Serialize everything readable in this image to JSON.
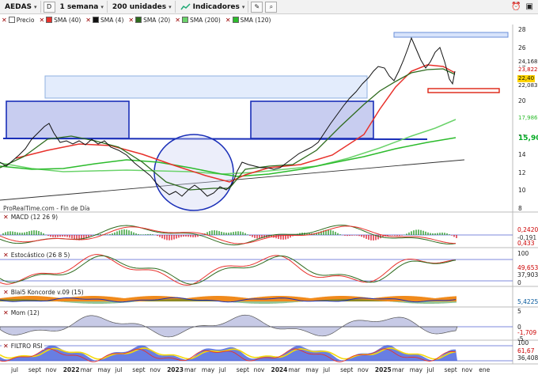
{
  "toolbar": {
    "symbol": "AEDAS",
    "period_letter": "D",
    "timeframe": "1 semana",
    "units": "200 unidades",
    "indicators": "Indicadores"
  },
  "legend": [
    {
      "label": "Precio",
      "color": "#ffffff"
    },
    {
      "label": "SMA (40)",
      "color": "#e8312b"
    },
    {
      "label": "SMA (4)",
      "color": "#111111"
    },
    {
      "label": "SMA (20)",
      "color": "#2e6b1e"
    },
    {
      "label": "SMA (200)",
      "color": "#6bd36b"
    },
    {
      "label": "SMA (120)",
      "color": "#2cbb2c"
    }
  ],
  "price_axis": [
    "28",
    "26",
    "24",
    "22",
    "20",
    "18",
    "16",
    "14",
    "12",
    "10",
    "8"
  ],
  "price_tags": [
    {
      "text": "24,168",
      "bg": "#ffffff",
      "color": "#222"
    },
    {
      "text": "23,822",
      "bg": "#ffffff",
      "color": "#c00"
    },
    {
      "text": "22,40",
      "bg": "#ffd400",
      "color": "#111"
    },
    {
      "text": "22,083",
      "bg": "#ffffff",
      "color": "#222"
    },
    {
      "text": "17,986",
      "bg": "#ffffff",
      "color": "#2cbb2c"
    },
    {
      "text": "15,90",
      "bg": "#ffffff",
      "color": "#0a2"
    }
  ],
  "footer": "ProRealTime.com - Fin de Día",
  "panels": {
    "macd": {
      "title": "MACD (12 26 9)",
      "values": [
        "0,2420",
        "-0,191",
        "0,433"
      ]
    },
    "stoch": {
      "title": "Estocástico (26 8 5)",
      "values": [
        "100",
        "49,653",
        "37,903",
        "0"
      ]
    },
    "koncorde": {
      "title": "Blai5 Koncorde v.09 (15)",
      "values": [
        "5,4225"
      ]
    },
    "mom": {
      "title": "Mom (12)",
      "values": [
        "5",
        "0",
        "-1,709",
        "-5"
      ]
    },
    "rsi": {
      "title": "FILTRO RSI",
      "values": [
        "100",
        "61,67",
        "36,408"
      ]
    }
  },
  "x_labels": [
    {
      "t": "jul",
      "b": false
    },
    {
      "t": "sept",
      "b": false
    },
    {
      "t": "nov",
      "b": false
    },
    {
      "t": "2022",
      "b": true
    },
    {
      "t": "mar",
      "b": false
    },
    {
      "t": "may",
      "b": false
    },
    {
      "t": "jul",
      "b": false
    },
    {
      "t": "sept",
      "b": false
    },
    {
      "t": "nov",
      "b": false
    },
    {
      "t": "2023",
      "b": true
    },
    {
      "t": "mar",
      "b": false
    },
    {
      "t": "may",
      "b": false
    },
    {
      "t": "jul",
      "b": false
    },
    {
      "t": "sept",
      "b": false
    },
    {
      "t": "nov",
      "b": false
    },
    {
      "t": "2024",
      "b": true
    },
    {
      "t": "mar",
      "b": false
    },
    {
      "t": "may",
      "b": false
    },
    {
      "t": "jul",
      "b": false
    },
    {
      "t": "sept",
      "b": false
    },
    {
      "t": "nov",
      "b": false
    },
    {
      "t": "2025",
      "b": true
    },
    {
      "t": "mar",
      "b": false
    },
    {
      "t": "may",
      "b": false
    },
    {
      "t": "jul",
      "b": false
    },
    {
      "t": "sept",
      "b": false
    },
    {
      "t": "nov",
      "b": false
    },
    {
      "t": "ene",
      "b": false
    }
  ],
  "colors": {
    "price_line": "#111111",
    "sma40": "#e8312b",
    "sma20": "#2e6b1e",
    "sma200": "#6bd36b",
    "sma120": "#2cbb2c",
    "support": "#1a2fb8",
    "zone": "#c8cdf0"
  }
}
